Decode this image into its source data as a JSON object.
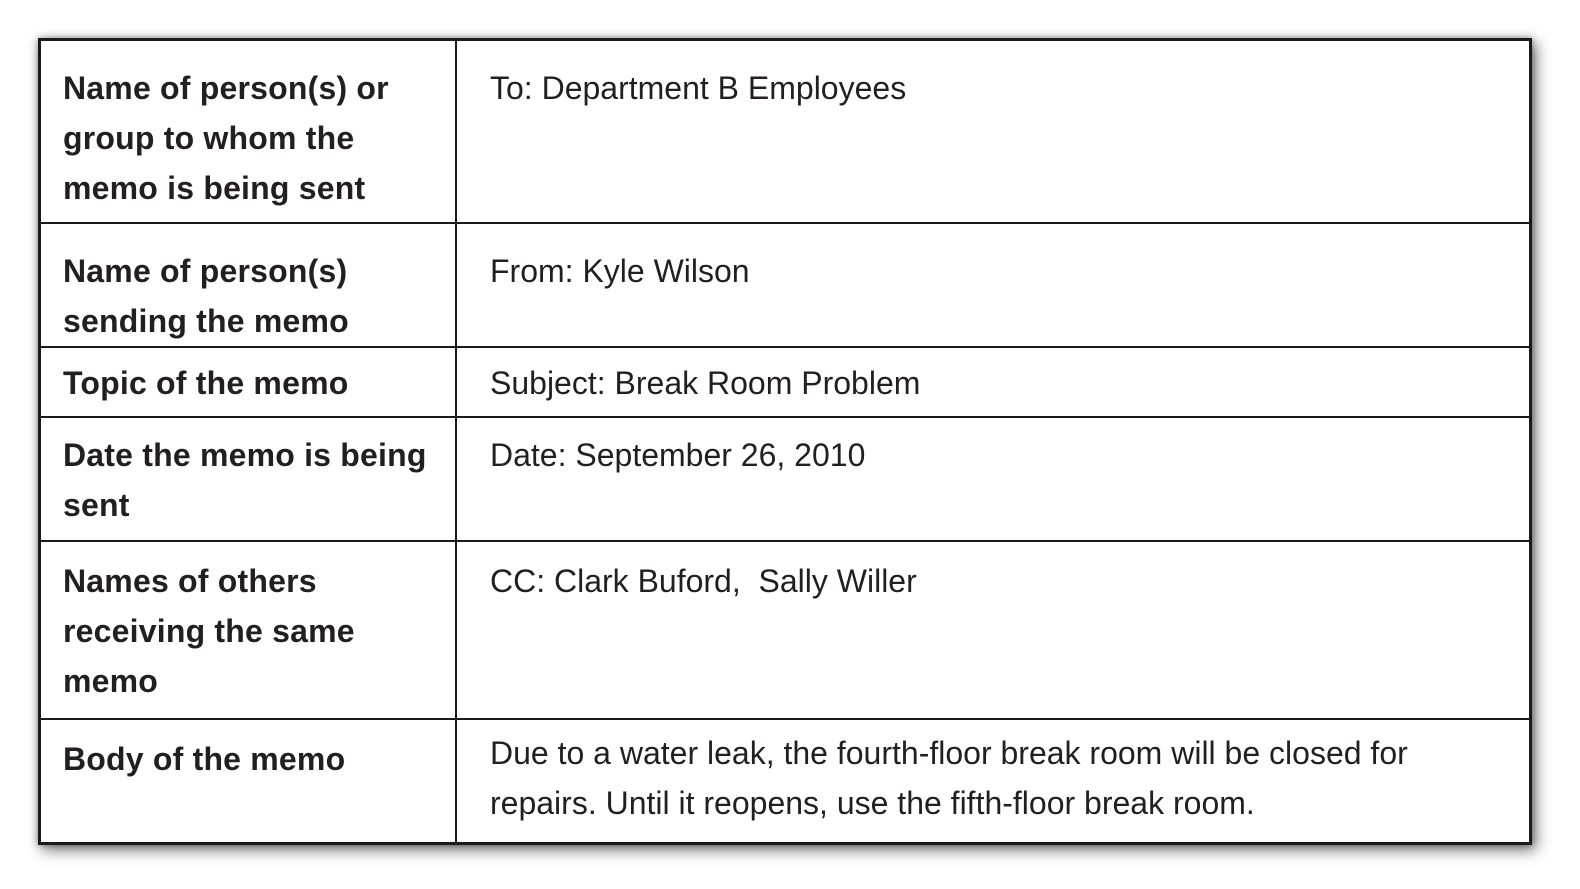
{
  "memo_table": {
    "rows": [
      {
        "label": "Name of person(s) or group to whom the memo is being sent",
        "value": "To: Department B Employees"
      },
      {
        "label": "Name of person(s) sending the memo",
        "value": "From: Kyle Wilson"
      },
      {
        "label": "Topic of the memo",
        "value": "Subject: Break Room Problem"
      },
      {
        "label": "Date the memo is being sent",
        "value": "Date: September 26, 2010"
      },
      {
        "label": "Names of others receiving the same memo",
        "value": "CC: Clark Buford,  Sally Willer"
      },
      {
        "label": "Body of the memo",
        "value": "Due to a water leak, the fourth-floor break room will be closed for repairs. Until it reopens, use the fifth-floor break room."
      }
    ]
  }
}
